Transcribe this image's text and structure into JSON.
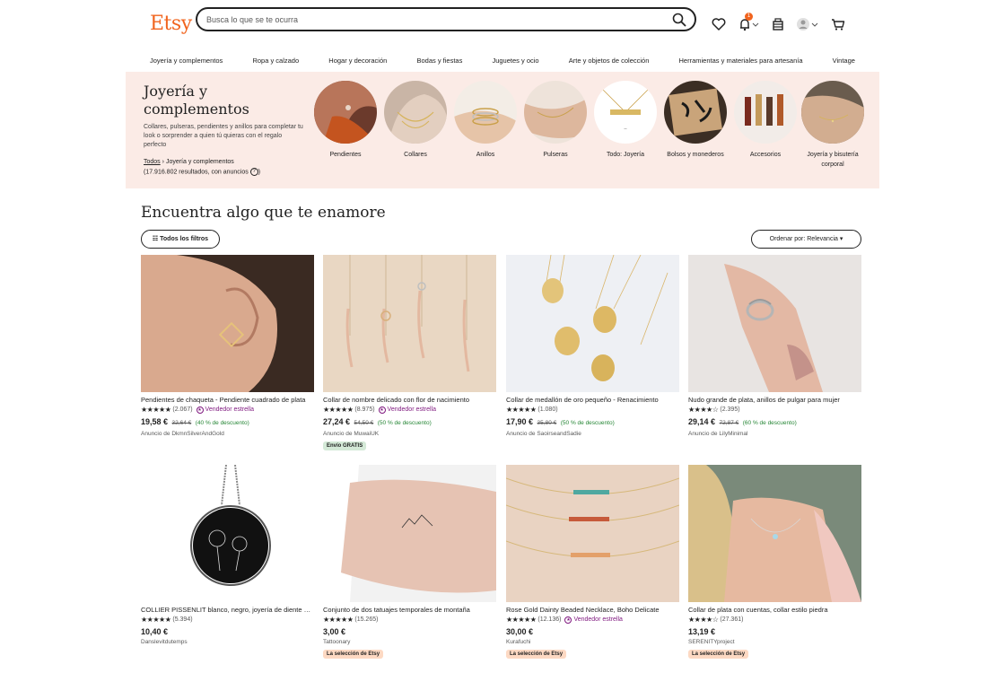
{
  "header": {
    "logo": "Etsy",
    "search_placeholder": "Busca lo que se te ocurra",
    "notification_count": "1"
  },
  "nav": [
    "Joyería y complementos",
    "Ropa y calzado",
    "Hogar y decoración",
    "Bodas y fiestas",
    "Juguetes y ocio",
    "Arte y objetos de colección",
    "Herramientas y materiales para artesanía",
    "Vintage"
  ],
  "banner": {
    "title": "Joyería y complementos",
    "description": "Collares, pulseras, pendientes y anillos para completar tu look o sorprender a quien tú quieras con el regalo perfecto",
    "crumb_all": "Todos",
    "crumb_sep": "›",
    "crumb_current": "Joyería y complementos",
    "count": "(17.916.802 resultados, con anuncios",
    "count_tail": ")",
    "info_icon": "?",
    "categories": [
      {
        "label": "Pendientes"
      },
      {
        "label": "Collares"
      },
      {
        "label": "Anillos"
      },
      {
        "label": "Pulseras"
      },
      {
        "label": "Todo: Joyería"
      },
      {
        "label": "Bolsos y monederos"
      },
      {
        "label": "Accesorios"
      },
      {
        "label": "Joyería y bisutería corporal"
      }
    ]
  },
  "section": {
    "title": "Encuentra algo que te enamore",
    "filters_label": "Todos los filtros",
    "sort_label": "Ordenar por: Relevancia"
  },
  "products": [
    {
      "title": "Pendientes de chaqueta - Pendiente cuadrado de plata",
      "stars": "★★★★★",
      "reviews": "(2.067)",
      "star_seller": "Vendedor estrella",
      "price": "19,58 €",
      "old_price": "32,64 €",
      "discount": "(40 % de descuento)",
      "shop": "Anuncio de DkmnSilverAndGold",
      "badge": ""
    },
    {
      "title": "Collar de nombre delicado con flor de nacimiento",
      "stars": "★★★★★",
      "reviews": "(8.975)",
      "star_seller": "Vendedor estrella",
      "price": "27,24 €",
      "old_price": "54,50 €",
      "discount": "(50 % de descuento)",
      "shop": "Anuncio de MuwaiUK",
      "badge": "Envío GRATIS"
    },
    {
      "title": "Collar de medallón de oro pequeño - Renacimiento",
      "stars": "★★★★★",
      "reviews": "(1.080)",
      "star_seller": "",
      "price": "17,90 €",
      "old_price": "35,80 €",
      "discount": "(50 % de descuento)",
      "shop": "Anuncio de SaoirseandSadie",
      "badge": ""
    },
    {
      "title": "Nudo grande de plata, anillos de pulgar para mujer",
      "stars": "★★★★☆",
      "reviews": "(2.395)",
      "star_seller": "",
      "price": "29,14 €",
      "old_price": "72,87 €",
      "discount": "(60 % de descuento)",
      "shop": "Anuncio de LilyMinimal",
      "badge": ""
    },
    {
      "title": "COLLIER PISSENLIT blanco, negro, joyería de diente de león",
      "stars": "★★★★★",
      "reviews": "(5.394)",
      "star_seller": "",
      "price": "10,40 €",
      "old_price": "",
      "discount": "",
      "shop": "Danslevitdutemps",
      "badge": ""
    },
    {
      "title": "Conjunto de dos tatuajes temporales de montaña",
      "stars": "★★★★★",
      "reviews": "(15.265)",
      "star_seller": "",
      "price": "3,00 €",
      "old_price": "",
      "discount": "",
      "shop": "Tattoonary",
      "badge": "La selección de Etsy"
    },
    {
      "title": "Rose Gold Dainty Beaded Necklace, Boho Delicate",
      "stars": "★★★★★",
      "reviews": "(12.136)",
      "star_seller": "Vendedor estrella",
      "price": "30,00 €",
      "old_price": "",
      "discount": "",
      "shop": "Kurafuchi",
      "badge": "La selección de Etsy"
    },
    {
      "title": "Collar de plata con cuentas, collar estilo piedra",
      "stars": "★★★★☆",
      "reviews": "(27.361)",
      "star_seller": "",
      "price": "13,19 €",
      "old_price": "",
      "discount": "",
      "shop": "SERENITYproject",
      "badge": "La selección de Etsy"
    }
  ],
  "colors": {
    "brand": "#f1641e",
    "banner_bg": "#fbebe6",
    "star_seller": "#7f187f",
    "discount": "#258635"
  }
}
